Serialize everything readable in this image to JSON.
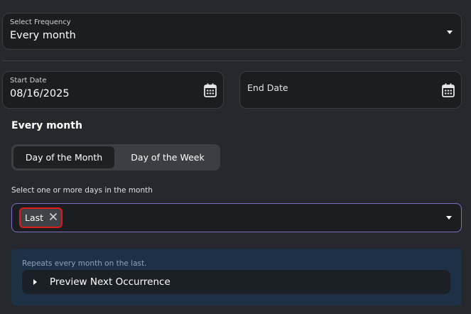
{
  "frequency": {
    "label": "Select Frequency",
    "value": "Every month"
  },
  "start_date": {
    "label": "Start Date",
    "value": "08/16/2025"
  },
  "end_date": {
    "label": "End Date"
  },
  "section_heading": "Every month",
  "mode_toggle": {
    "options": [
      "Day of the Month",
      "Day of the Week"
    ],
    "selected": "Day of the Month"
  },
  "days_select": {
    "hint": "Select one or more days in the month",
    "chips": [
      "Last"
    ]
  },
  "summary": {
    "text": "Repeats every month on the last.",
    "preview_label": "Preview Next Occurrence"
  },
  "colors": {
    "background": "#25282c",
    "field": "#1b1d20",
    "focus_border": "#7f6fc3",
    "summary_bg": "#1e3045",
    "highlight": "#e01b1b"
  }
}
